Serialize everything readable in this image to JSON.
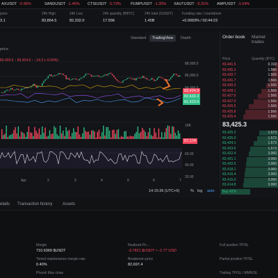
{
  "ticker": [
    {
      "symbol": "AXUSDT",
      "change": "-0.96%",
      "dir": "neg"
    },
    {
      "symbol": "SANDUSDT",
      "change": "-1.46%",
      "dir": "neg"
    },
    {
      "symbol": "CTSIUSDT",
      "change": "-0.73%",
      "dir": "neg"
    },
    {
      "symbol": "PUMPUSDT",
      "change": "-1.35%",
      "dir": "neg"
    },
    {
      "symbol": "XAUTUSDT",
      "change": "-0.31%",
      "dir": "neg"
    },
    {
      "symbol": "AMPUSDT",
      "change": "-1.54%",
      "dir": "neg"
    }
  ],
  "stats": [
    {
      "label": "price",
      "value": "3.1"
    },
    {
      "label": "24h High",
      "value": "83,864.5"
    },
    {
      "label": "24h Low",
      "value": "82,332.0"
    },
    {
      "label": "24h quantity (BBTC)",
      "value": "17.55K"
    },
    {
      "label": "24h total (SUSDT)",
      "value": "1.45B"
    },
    {
      "label": "Funding rate / countdown",
      "value": "+0.0093% / 02:44:23"
    }
  ],
  "chart_view": {
    "standard": "Standard",
    "tradingview": "TradingView",
    "depth": "Depth"
  },
  "chart_header": {
    "label": "price",
    "ohlc": "83,403.5 ↑ 83,424.9 ↑ −14.3 (−0.04%)"
  },
  "price_axis": [
    "88,000.0",
    "86,000.0",
    "84,000.0",
    "82,000.0",
    "10K",
    "60.00",
    "40.00",
    "20.00"
  ],
  "price_tags": [
    {
      "value": "83,424.9",
      "color": "#f6465d"
    },
    {
      "value": "82,632.2",
      "color": "#2ebd85"
    },
    {
      "value": "81,423.0",
      "color": "#2ebd85"
    },
    {
      "value": "57,174",
      "color": "#f6465d"
    }
  ],
  "time_axis": [
    "Apr",
    "2",
    "3",
    "4",
    "5",
    "6",
    "7"
  ],
  "chart_footer": {
    "time": "14:15:36 (UTC+9)",
    "pct": "%",
    "log": "log",
    "auto": "auto"
  },
  "orderbook": {
    "tab1": "Order book",
    "tab2": "Market trades",
    "col_price": "Price",
    "col_qty": "Quantity (BTC)",
    "asks": [
      "83,441.5",
      "83,435.2",
      "83,432.7",
      "83,431.7",
      "83,430.2",
      "83,428.1",
      "83,427.6",
      "83,427.0",
      "83,426.5",
      "83,425.8",
      "83,425.4"
    ],
    "ask_qty": [
      "0.192",
      "1.566",
      "1.566",
      "1.566",
      "1.566",
      "1.566",
      "1.566",
      "1.566",
      "1.566",
      "1.566",
      "1.566"
    ],
    "mid_price": "83,425.3",
    "bids": [
      "83,425.2",
      "83,425.0",
      "83,424.1",
      "83,423.6",
      "83,422.4",
      "83,421.1",
      "83,420.5",
      "83,418.1",
      "83,416.4",
      "83,415.0",
      "83,414.8"
    ],
    "bid_qty": [
      "1.573",
      "1.573",
      "1.573",
      "1.573",
      "3.060",
      "3.060",
      "3.060",
      "3.060",
      "3.060",
      "3.060",
      "3.060"
    ],
    "buy_label": "Buy 42%",
    "ask_depth": [
      0.05,
      0.1,
      0.12,
      0.14,
      0.2,
      0.28,
      0.35,
      0.42,
      0.5,
      0.56,
      0.6
    ],
    "bid_depth": [
      0.55,
      0.6,
      0.7,
      0.8,
      0.85,
      0.9,
      0.92,
      0.95,
      0.97,
      0.98,
      1.0
    ]
  },
  "tabs": {
    "details": "etails",
    "history": "Transaction history",
    "assets": "Assets"
  },
  "position": {
    "margin_label": "Margin",
    "margin_value": "710.6369 $USDT",
    "realized_label": "Realized Pn...",
    "realized_value": "-3.7821 $USDT ≈ -2.77 USD",
    "tiered_label": "Tiered maintenance margin rate",
    "tiered_value": "0.40%",
    "breakeven_label": "Breakeven price",
    "breakeven_value": "82,697.4",
    "full_tpsl": "Full position TP/SL",
    "partial_tpsl": "Partial position TP/SL",
    "mmr_label": "Trailing TP/SL / MMR/SL",
    "close_label": "Phorsli Max close"
  },
  "colors": {
    "up": "#2ebd85",
    "down": "#f6465d",
    "accent": "#f0772b"
  }
}
